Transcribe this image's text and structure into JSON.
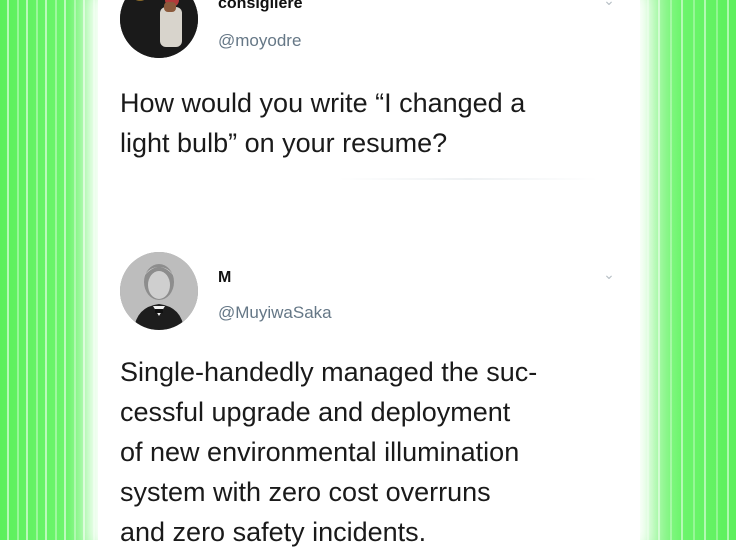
{
  "tweets": [
    {
      "display_name": "consigliere",
      "handle": "@moyodre",
      "avatar_icon": "profile-photo",
      "menu_icon": "chevron-down-icon",
      "text_lines": [
        "How would you write “I changed a",
        "light bulb” on your resume?"
      ]
    },
    {
      "display_name": "M",
      "handle": "@MuyiwaSaka",
      "avatar_icon": "profile-photo",
      "menu_icon": "chevron-down-icon",
      "text_lines": [
        "Single-handedly managed the suc-",
        "cessful upgrade and deployment",
        "of new environmental illumination",
        "system with zero cost overruns",
        "and zero safety incidents."
      ]
    }
  ],
  "colors": {
    "frame": "#5cf05c",
    "handle": "#657786",
    "text": "#1a1a1a"
  }
}
